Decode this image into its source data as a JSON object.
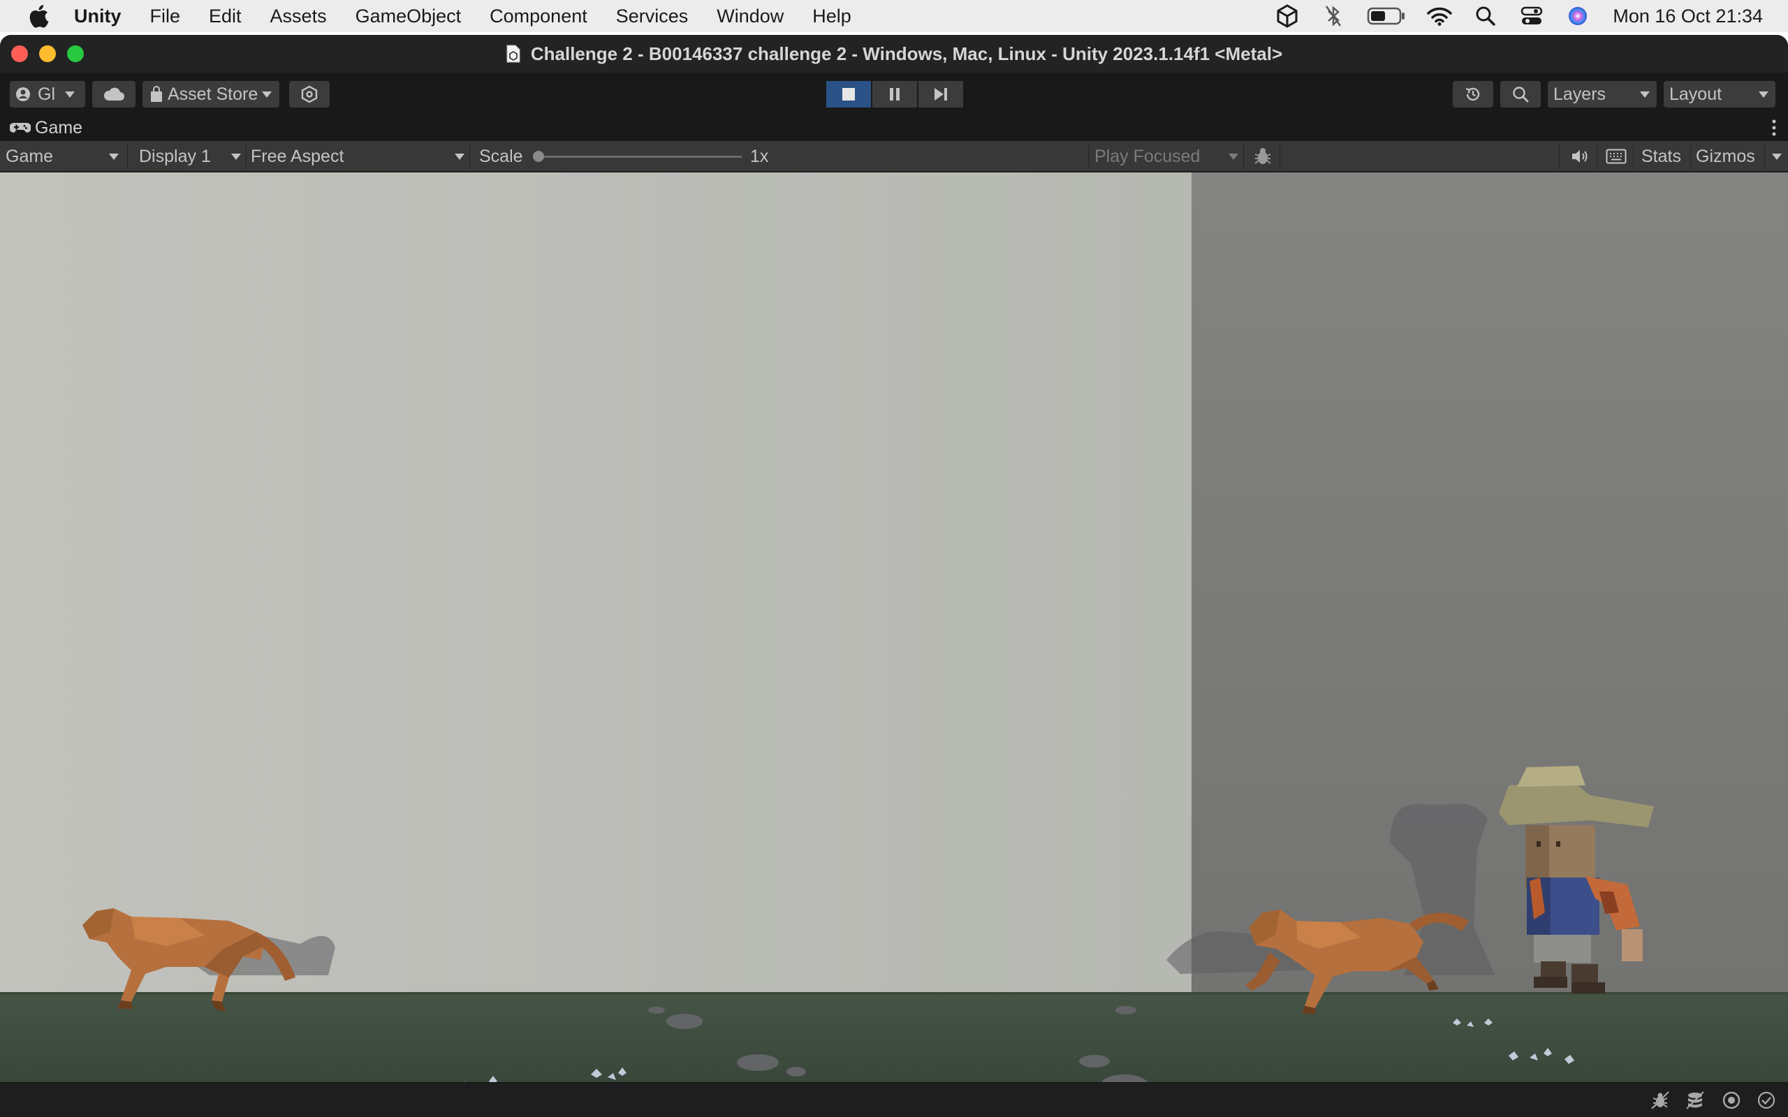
{
  "menubar": {
    "app_name": "Unity",
    "items": [
      "File",
      "Edit",
      "Assets",
      "GameObject",
      "Component",
      "Services",
      "Window",
      "Help"
    ],
    "clock": "Mon 16 Oct  21:34"
  },
  "window": {
    "title": "Challenge 2 - B00146337 challenge 2 - Windows, Mac, Linux - Unity 2023.1.14f1 <Metal>"
  },
  "toolbar": {
    "account_label": "Gl",
    "asset_store_label": "Asset Store",
    "layers_label": "Layers",
    "layout_label": "Layout"
  },
  "game_tab": {
    "label": "Game"
  },
  "game_bar": {
    "view_mode": "Game",
    "display": "Display 1",
    "aspect": "Free Aspect",
    "scale_label": "Scale",
    "scale_value": "1x",
    "play_mode": "Play Focused",
    "stats_label": "Stats",
    "gizmos_label": "Gizmos"
  },
  "colors": {
    "menubar_bg": "#ececec",
    "window_bg": "#191919",
    "toolbar_button": "#3c3c3c",
    "play_active": "#2b5286",
    "sky_light": "#bcbcb6",
    "sky_dark": "#7a7a78",
    "ground": "#3e4d3b",
    "dog": "#b5703e"
  }
}
